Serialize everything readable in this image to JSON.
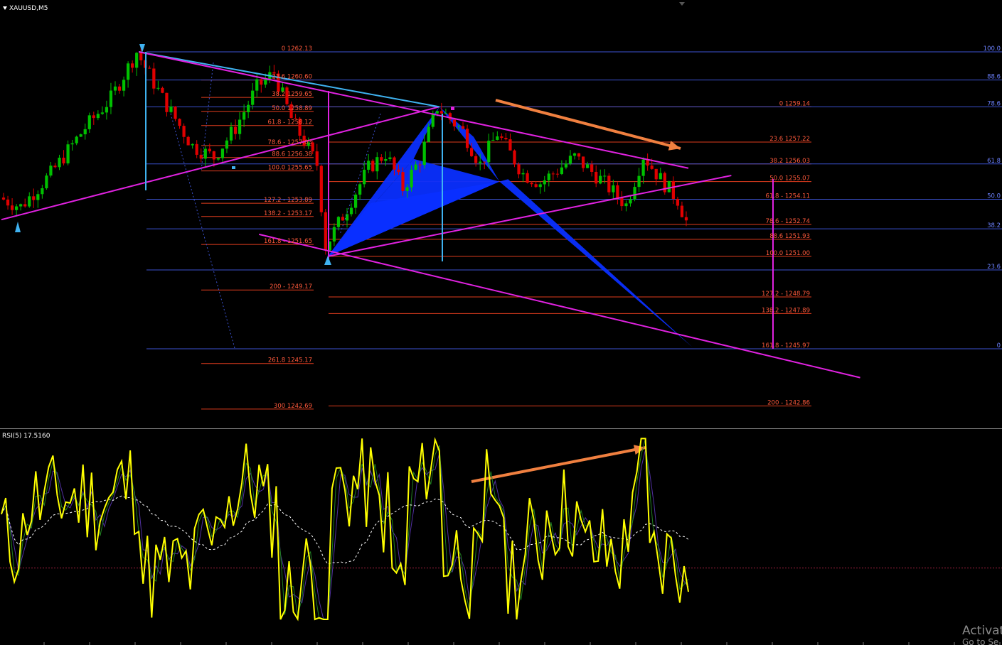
{
  "main_title": "XAUUSD,M5",
  "rsi_title": "RSI(5) 17.5160",
  "watermark": "Activat",
  "watermark_sub": "Go to Se",
  "colors": {
    "background": "#000000",
    "bull": "#00c000",
    "bear": "#e00000",
    "fib_blue": "#3b52d0",
    "fib_red": "#e03c1e",
    "fib_red_text": "#ff5a3c",
    "fib_blue_text": "#6d82ff",
    "magenta": "#e022e0",
    "light_blue": "#3fb2f0",
    "pattern": "#0a2fff",
    "arrow": "#f08040",
    "rsi_line": "#ffff00"
  },
  "icons": [
    "dropdown-triangle-icon",
    "arrow-up-icon",
    "arrow-down-icon"
  ],
  "chart_data": [
    {
      "type": "candlestick",
      "symbol": "XAUUSD",
      "timeframe": "M5",
      "ylim": [
        1241.5,
        1263.5
      ],
      "candles_count": 160,
      "price_path_description_points": [
        [
          0,
          1254.2
        ],
        [
          5,
          1253.7
        ],
        [
          12,
          1255.5
        ],
        [
          20,
          1258.0
        ],
        [
          26,
          1259.6
        ],
        [
          32,
          1262.13
        ],
        [
          38,
          1259.6
        ],
        [
          45,
          1257.0
        ],
        [
          50,
          1256.4
        ],
        [
          55,
          1258.0
        ],
        [
          60,
          1260.2
        ],
        [
          64,
          1261.0
        ],
        [
          68,
          1258.5
        ],
        [
          74,
          1256.0
        ],
        [
          76,
          1251.55
        ],
        [
          80,
          1253.2
        ],
        [
          86,
          1255.8
        ],
        [
          90,
          1256.6
        ],
        [
          94,
          1254.7
        ],
        [
          98,
          1256.3
        ],
        [
          102,
          1259.14
        ],
        [
          108,
          1257.8
        ],
        [
          112,
          1256.0
        ],
        [
          116,
          1257.7
        ],
        [
          122,
          1255.5
        ],
        [
          126,
          1255.0
        ],
        [
          134,
          1256.4
        ],
        [
          140,
          1255.2
        ],
        [
          146,
          1253.8
        ],
        [
          150,
          1256.5
        ],
        [
          154,
          1255.2
        ],
        [
          158,
          1254.1
        ],
        [
          160,
          1252.9
        ]
      ],
      "fib_sets": [
        {
          "name": "right_retracement",
          "color": "red",
          "levels": [
            {
              "label": "0 1259.14",
              "price": 1259.14
            },
            {
              "label": "23.6 1257.22",
              "price": 1257.22
            },
            {
              "label": "38.2 1256.03",
              "price": 1256.03
            },
            {
              "label": "50.0 1255.07",
              "price": 1255.07
            },
            {
              "label": "61.8 - 1254.11",
              "price": 1254.11
            },
            {
              "label": "78.6 - 1252.74",
              "price": 1252.74
            },
            {
              "label": "88.6 1251.93",
              "price": 1251.93
            },
            {
              "label": "100.0 1251.00",
              "price": 1251.0
            },
            {
              "label": "127.2 - 1248.79",
              "price": 1248.79
            },
            {
              "label": "138.2 - 1247.89",
              "price": 1247.89
            },
            {
              "label": "161.8 - 1245.97",
              "price": 1245.97
            },
            {
              "label": "200 - 1242.86",
              "price": 1242.86
            }
          ]
        },
        {
          "name": "left_retracement",
          "color": "red",
          "levels": [
            {
              "label": "0 1262.13",
              "price": 1262.13
            },
            {
              "label": "23.6 1260.60",
              "price": 1260.6
            },
            {
              "label": "38.2 1259.65",
              "price": 1259.65
            },
            {
              "label": "50.0 1258.89",
              "price": 1258.89
            },
            {
              "label": "61.8 - 1258.12",
              "price": 1258.12
            },
            {
              "label": "78.6 - 1257.03",
              "price": 1257.03
            },
            {
              "label": "88.6 1256.38",
              "price": 1256.38
            },
            {
              "label": "100.0 1255.65",
              "price": 1255.65
            },
            {
              "label": "127.2 - 1253.89",
              "price": 1253.89
            },
            {
              "label": "138.2 - 1253.17",
              "price": 1253.17
            },
            {
              "label": "161.8 - 1251.65",
              "price": 1251.65
            },
            {
              "label": "200 - 1249.17",
              "price": 1249.17
            },
            {
              "label": "261.8 1245.17",
              "price": 1245.17
            },
            {
              "label": "300 1242.69",
              "price": 1242.69
            }
          ]
        },
        {
          "name": "blue_retracement",
          "color": "blue",
          "levels": [
            {
              "label": "100.0",
              "price": 1262.13
            },
            {
              "label": "88.6",
              "price": 1260.6
            },
            {
              "label": "78.6",
              "price": 1259.14
            },
            {
              "label": "61.8",
              "price": 1256.03
            },
            {
              "label": "50.0",
              "price": 1254.11
            },
            {
              "label": "38.2",
              "price": 1252.5
            },
            {
              "label": "23.6",
              "price": 1250.26
            },
            {
              "label": "0",
              "price": 1245.97
            }
          ]
        }
      ],
      "pattern": {
        "type": "harmonic",
        "points": [
          [
            76,
            1251.0
          ],
          [
            102,
            1259.14
          ],
          [
            116,
            1255.07
          ],
          [
            152,
            1245.97
          ]
        ]
      },
      "trendlines": [
        {
          "color": "magenta",
          "from": [
            0,
            1253.0
          ],
          "to": [
            102,
            1259.14
          ]
        },
        {
          "color": "light_blue",
          "from": [
            32,
            1262.13
          ],
          "to": [
            102,
            1259.14
          ]
        },
        {
          "color": "magenta",
          "from": [
            32,
            1262.13
          ],
          "to": [
            160,
            1255.8
          ]
        },
        {
          "color": "magenta",
          "from": [
            76,
            1251.0
          ],
          "to": [
            170,
            1255.4
          ]
        },
        {
          "color": "magenta",
          "from": [
            60,
            1252.2
          ],
          "to": [
            200,
            1244.4
          ]
        }
      ]
    },
    {
      "type": "line",
      "name": "RSI(5)",
      "value": 17.516,
      "ylim": [
        0,
        100
      ]
    }
  ]
}
